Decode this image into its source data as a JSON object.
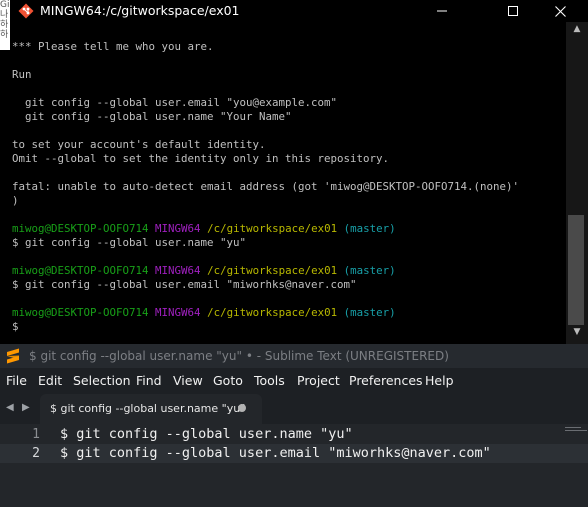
{
  "terminal": {
    "title": "MINGW64:/c/gitworkspace/ex01",
    "left_strip_text": [
      "Gi",
      "나하",
      "하"
    ],
    "lines": [
      {
        "text": "*** Please tell me who you are."
      },
      {
        "text": ""
      },
      {
        "text": "Run"
      },
      {
        "text": ""
      },
      {
        "text": "  git config --global user.email \"you@example.com\""
      },
      {
        "text": "  git config --global user.name \"Your Name\""
      },
      {
        "text": ""
      },
      {
        "text": "to set your account's default identity."
      },
      {
        "text": "Omit --global to set the identity only in this repository."
      },
      {
        "text": ""
      },
      {
        "text": "fatal: unable to auto-detect email address (got 'miwog@DESKTOP-OOFO714.(none)'"
      },
      {
        "text": ")"
      }
    ],
    "prompts": [
      {
        "user": "miwog@DESKTOP-OOFO714",
        "shell": "MINGW64",
        "path": "/c/gitworkspace/ex01",
        "branch": "(master)",
        "command": "$ git config --global user.name \"yu\""
      },
      {
        "user": "miwog@DESKTOP-OOFO714",
        "shell": "MINGW64",
        "path": "/c/gitworkspace/ex01",
        "branch": "(master)",
        "command": "$ git config --global user.email \"miworhks@naver.com\""
      },
      {
        "user": "miwog@DESKTOP-OOFO714",
        "shell": "MINGW64",
        "path": "/c/gitworkspace/ex01",
        "branch": "(master)",
        "command": "$"
      }
    ],
    "controls": {
      "minimize": "minimize-icon",
      "maximize": "maximize-icon",
      "close": "close-icon"
    },
    "colors": {
      "background": "#000000",
      "text": "#c0c0c0",
      "user": "#18a018",
      "shell": "#a020c0",
      "path": "#b8b800",
      "branch": "#18a0a8"
    }
  },
  "sublime": {
    "title": "$ git config --global user.name \"yu\" • - Sublime Text (UNREGISTERED)",
    "menu": [
      "File",
      "Edit",
      "Selection",
      "Find",
      "View",
      "Goto",
      "Tools",
      "Project",
      "Preferences",
      "Help"
    ],
    "tab_label": "$ git config --global user.name \"yu\"",
    "lines": [
      {
        "number": "1",
        "text": "$ git config --global user.name \"yu\""
      },
      {
        "number": "2",
        "text": "$ git config --global user.email \"miworhks@naver.com\""
      }
    ],
    "colors": {
      "background": "#23262a",
      "menu_background": "#1d2024",
      "text": "#f0f0f0",
      "gutter": "#8b8e92"
    }
  }
}
